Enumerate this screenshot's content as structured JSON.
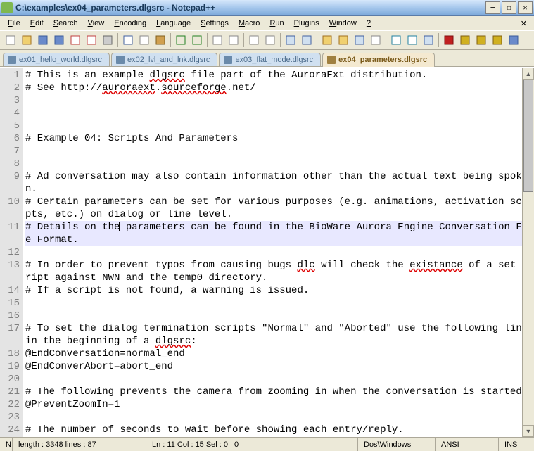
{
  "window": {
    "title": "C:\\examples\\ex04_parameters.dlgsrc - Notepad++"
  },
  "menu": {
    "items": [
      "File",
      "Edit",
      "Search",
      "View",
      "Encoding",
      "Language",
      "Settings",
      "Macro",
      "Run",
      "Plugins",
      "Window",
      "?"
    ]
  },
  "tabs": [
    {
      "label": "ex01_hello_world.dlgsrc",
      "active": false
    },
    {
      "label": "ex02_lvl_and_lnk.dlgsrc",
      "active": false
    },
    {
      "label": "ex03_flat_mode.dlgsrc",
      "active": false
    },
    {
      "label": "ex04_parameters.dlgsrc",
      "active": true
    }
  ],
  "code": {
    "lines": [
      {
        "n": 1,
        "text": "# This is an example dlgsrc file part of the AuroraExt distribution.",
        "wavy": [
          "dlgsrc"
        ]
      },
      {
        "n": 2,
        "text": "# See http://auroraext.sourceforge.net/",
        "wavy": [
          "auroraext",
          "sourceforge"
        ]
      },
      {
        "n": 3,
        "text": ""
      },
      {
        "n": 4,
        "text": ""
      },
      {
        "n": 5,
        "text": ""
      },
      {
        "n": 6,
        "text": "# Example 04: Scripts And Parameters"
      },
      {
        "n": 7,
        "text": ""
      },
      {
        "n": 8,
        "text": ""
      },
      {
        "n": 9,
        "text": "# Ad conversation may also contain information other than the actual text being spoken.",
        "wrap": true
      },
      {
        "n": 10,
        "text": "# Certain parameters can be set for various purposes (e.g. animations, activation scripts, etc.) on dialog or line level.",
        "wrap": true
      },
      {
        "n": 11,
        "text": "# Details on the parameters can be found in the BioWare Aurora Engine Conversation File Format.",
        "current": true,
        "wrap": true
      },
      {
        "n": 12,
        "text": ""
      },
      {
        "n": 13,
        "text": "# In order to prevent typos from causing bugs dlc will check the existance of a set script against NWN and the temp0 directory.",
        "wrap": true,
        "wavy": [
          "dlc",
          "existance"
        ]
      },
      {
        "n": 14,
        "text": "# If a script is not found, a warning is issued."
      },
      {
        "n": 15,
        "text": ""
      },
      {
        "n": 16,
        "text": ""
      },
      {
        "n": 17,
        "text": "# To set the dialog termination scripts \"Normal\" and \"Aborted\" use the following lines in the beginning of a dlgsrc:",
        "wrap": true,
        "wavy": [
          "dlgsrc"
        ]
      },
      {
        "n": 18,
        "text": "@EndConversation=normal_end"
      },
      {
        "n": 19,
        "text": "@EndConverAbort=abort_end"
      },
      {
        "n": 20,
        "text": ""
      },
      {
        "n": 21,
        "text": "# The following prevents the camera from zooming in when the conversation is started."
      },
      {
        "n": 22,
        "text": "@PreventZoomIn=1"
      },
      {
        "n": 23,
        "text": ""
      },
      {
        "n": 24,
        "text": "# The number of seconds to wait before showing each entry/reply."
      }
    ]
  },
  "status": {
    "cell1": "N",
    "length_lines": "length : 3348    lines : 87",
    "pos": "Ln : 11   Col : 15   Sel : 0 | 0",
    "eol": "Dos\\Windows",
    "enc": "ANSI",
    "ins": "INS"
  },
  "toolbar_icons": [
    {
      "name": "new",
      "fill": "#fff",
      "stroke": "#888"
    },
    {
      "name": "open",
      "fill": "#f0d070",
      "stroke": "#a07020"
    },
    {
      "name": "save",
      "fill": "#6a8aca",
      "stroke": "#3a5a9a"
    },
    {
      "name": "save-all",
      "fill": "#6a8aca",
      "stroke": "#3a5a9a"
    },
    {
      "name": "close",
      "fill": "#fff",
      "stroke": "#c04040"
    },
    {
      "name": "close-all",
      "fill": "#fff",
      "stroke": "#c04040"
    },
    {
      "name": "print",
      "fill": "#ccc",
      "stroke": "#666"
    },
    {
      "name": "sep"
    },
    {
      "name": "cut",
      "fill": "#fff",
      "stroke": "#4060a0"
    },
    {
      "name": "copy",
      "fill": "#fff",
      "stroke": "#888"
    },
    {
      "name": "paste",
      "fill": "#d0a050",
      "stroke": "#806020"
    },
    {
      "name": "sep"
    },
    {
      "name": "undo",
      "fill": "none",
      "stroke": "#208020"
    },
    {
      "name": "redo",
      "fill": "none",
      "stroke": "#208020"
    },
    {
      "name": "sep"
    },
    {
      "name": "find",
      "fill": "#fff",
      "stroke": "#888"
    },
    {
      "name": "replace",
      "fill": "#fff",
      "stroke": "#888"
    },
    {
      "name": "sep"
    },
    {
      "name": "zoom-in",
      "fill": "#fff",
      "stroke": "#888"
    },
    {
      "name": "zoom-out",
      "fill": "#fff",
      "stroke": "#888"
    },
    {
      "name": "sep"
    },
    {
      "name": "sync-v",
      "fill": "#d0e0f0",
      "stroke": "#4060a0"
    },
    {
      "name": "sync-h",
      "fill": "#d0e0f0",
      "stroke": "#4060a0"
    },
    {
      "name": "sep"
    },
    {
      "name": "wordwrap",
      "fill": "#f0d070",
      "stroke": "#a07020"
    },
    {
      "name": "allchars",
      "fill": "#f0d070",
      "stroke": "#a07020"
    },
    {
      "name": "indent-guide",
      "fill": "#d0e0f0",
      "stroke": "#4060a0"
    },
    {
      "name": "lang",
      "fill": "#fff",
      "stroke": "#888"
    },
    {
      "name": "sep"
    },
    {
      "name": "fold",
      "fill": "#fff",
      "stroke": "#2080a0"
    },
    {
      "name": "unfold",
      "fill": "#fff",
      "stroke": "#2080a0"
    },
    {
      "name": "doc-map",
      "fill": "#d0e0f0",
      "stroke": "#4060a0"
    },
    {
      "name": "sep"
    },
    {
      "name": "record",
      "fill": "#c02020",
      "stroke": "#801010"
    },
    {
      "name": "stop",
      "fill": "#d0b020",
      "stroke": "#806010"
    },
    {
      "name": "play",
      "fill": "#d0b020",
      "stroke": "#806010"
    },
    {
      "name": "play-multi",
      "fill": "#d0b020",
      "stroke": "#806010"
    },
    {
      "name": "save-macro",
      "fill": "#6a8aca",
      "stroke": "#3a5a9a"
    }
  ]
}
